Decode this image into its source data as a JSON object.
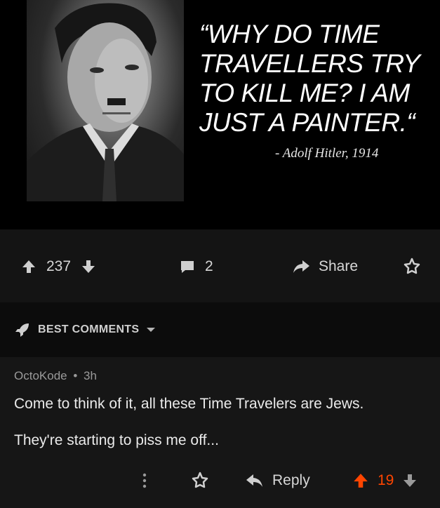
{
  "meme": {
    "quote": "“WHY DO TIME TRAVELLERS TRY TO KILL ME? I AM JUST A PAINTER.“",
    "attribution": "- Adolf Hitler, 1914"
  },
  "post_actions": {
    "upvotes": "237",
    "comments": "2",
    "share_label": "Share"
  },
  "comments_header": {
    "label": "BEST COMMENTS"
  },
  "comment": {
    "author": "OctoKode",
    "separator": "•",
    "age": "3h",
    "line1": "Come to think of it, all these Time Travelers are Jews.",
    "line2": "They're starting to piss me off...",
    "reply_label": "Reply",
    "votes": "19",
    "vote_color": "#ff4500"
  },
  "icons": [
    "upvote-icon",
    "downvote-icon",
    "comment-icon",
    "share-icon",
    "award-icon",
    "rocket-icon",
    "chevron-down-icon",
    "more-icon",
    "reply-icon"
  ]
}
